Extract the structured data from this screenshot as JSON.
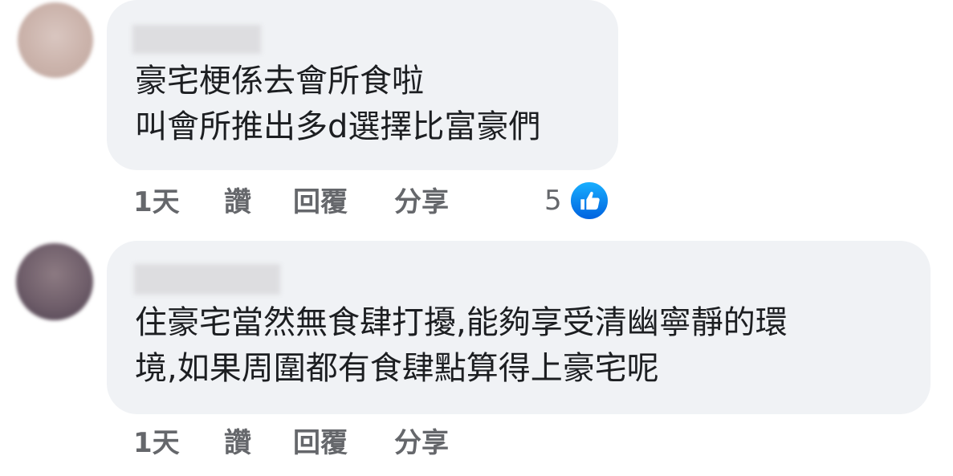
{
  "comments": [
    {
      "text_lines": [
        "豪宅梗係去會所食啦",
        "叫會所推出多d選擇比富豪們"
      ],
      "actions": {
        "time": "1天",
        "like": "讚",
        "reply": "回覆",
        "share": "分享"
      },
      "reaction_count": "5",
      "reaction_icon": "like-thumb-icon"
    },
    {
      "text_lines": [
        "住豪宅當然無食肆打擾,能夠享受清幽寧靜的環",
        "境,如果周圍都有食肆點算得上豪宅呢"
      ],
      "actions": {
        "time": "1天",
        "like": "讚",
        "reply": "回覆",
        "share": "分享"
      }
    }
  ],
  "colors": {
    "bubble": "#f0f2f5",
    "text": "#1c1e21",
    "meta": "#65676b",
    "like_badge": "#0866ff"
  }
}
